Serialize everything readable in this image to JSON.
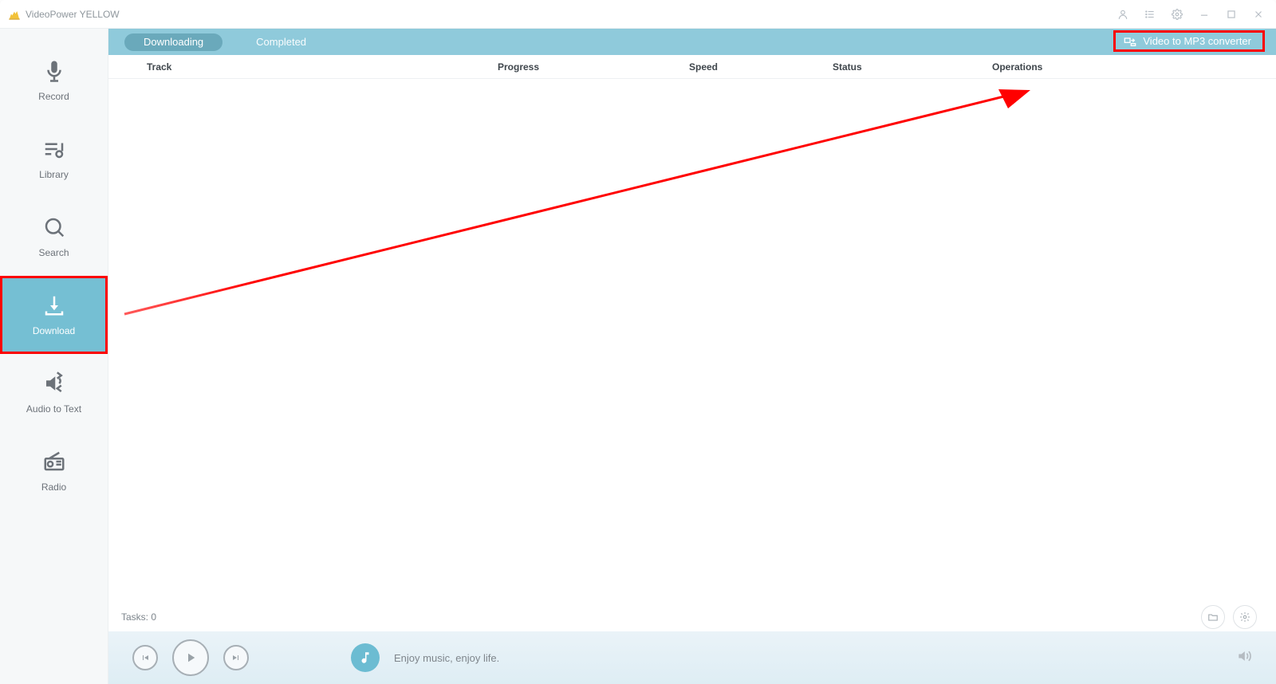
{
  "app": {
    "title": "VideoPower YELLOW"
  },
  "sidebar": {
    "items": [
      {
        "label": "Record"
      },
      {
        "label": "Library"
      },
      {
        "label": "Search"
      },
      {
        "label": "Download"
      },
      {
        "label": "Audio to Text"
      },
      {
        "label": "Radio"
      }
    ],
    "active_index": 3
  },
  "tabs": {
    "items": [
      {
        "label": "Downloading"
      },
      {
        "label": "Completed"
      }
    ],
    "active_index": 0,
    "converter_label": "Video to MP3 converter"
  },
  "columns": {
    "track": "Track",
    "progress": "Progress",
    "speed": "Speed",
    "status": "Status",
    "operations": "Operations"
  },
  "status_bar": {
    "tasks_label": "Tasks: 0"
  },
  "player": {
    "now_playing": "Enjoy music, enjoy life."
  }
}
